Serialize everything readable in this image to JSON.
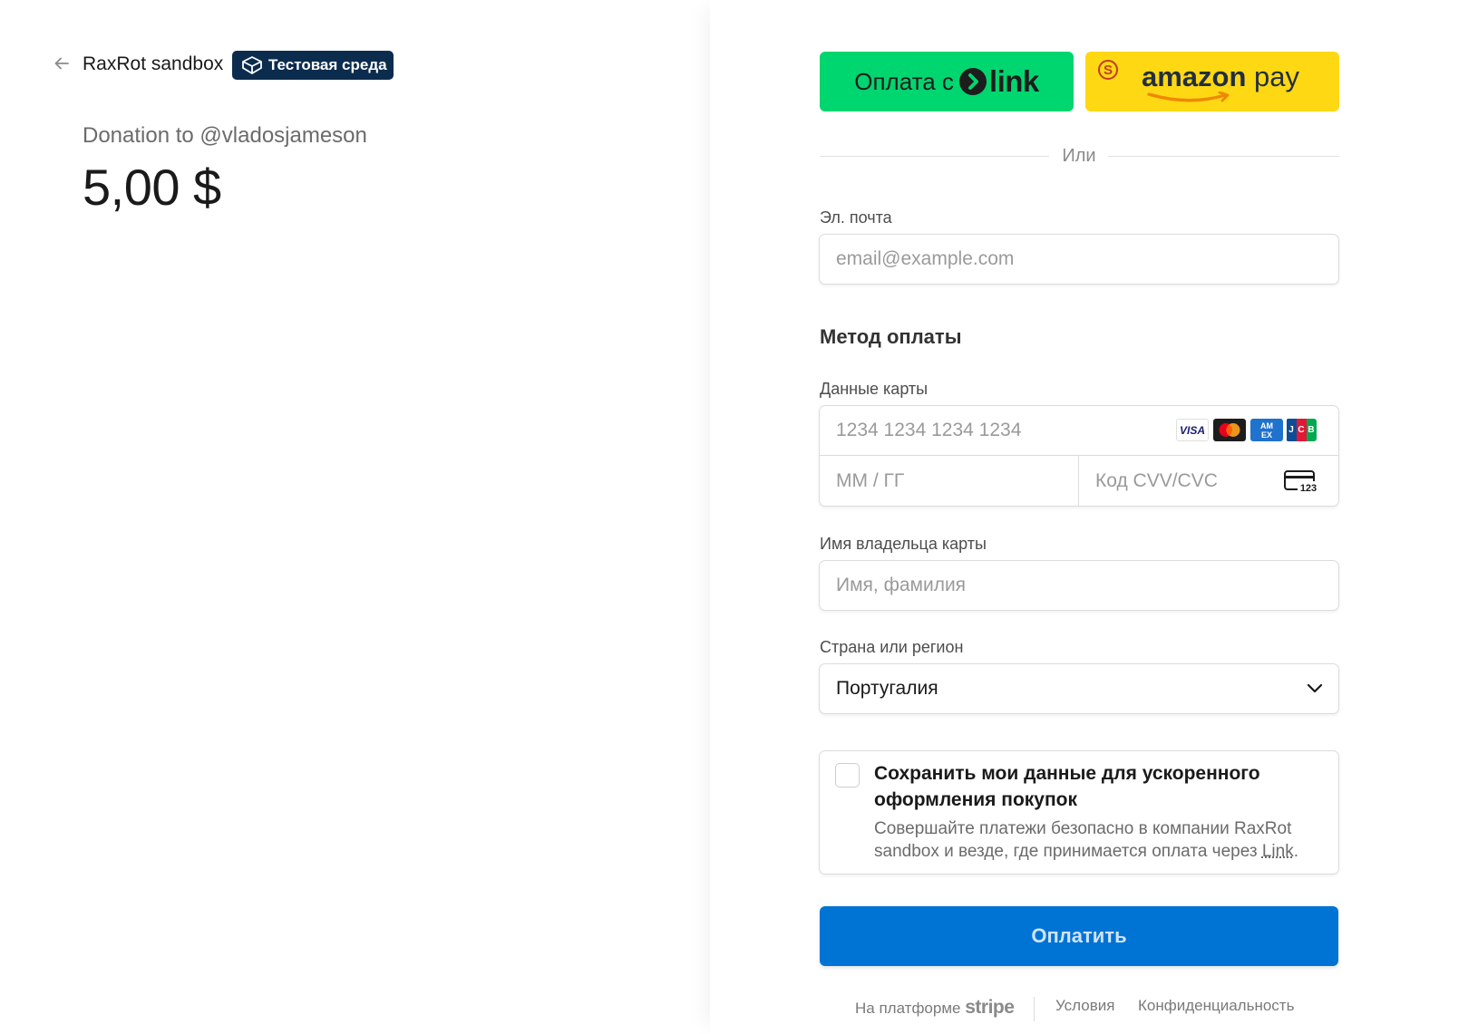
{
  "header": {
    "merchant_name": "RaxRot sandbox",
    "test_badge": "Тестовая среда"
  },
  "summary": {
    "description": "Donation to @vladosjameson",
    "amount": "5,00 $"
  },
  "wallets": {
    "link_prefix": "Оплата с",
    "link_word": "link",
    "amazon_word": "amazon",
    "amazon_pay": "pay"
  },
  "divider_text": "Или",
  "email": {
    "label": "Эл. почта",
    "placeholder": "email@example.com"
  },
  "payment_method_title": "Метод оплаты",
  "card": {
    "label": "Данные карты",
    "number_placeholder": "1234 1234 1234 1234",
    "expiry_placeholder": "ММ / ГГ",
    "cvc_placeholder": "Код CVV/CVC",
    "brands": {
      "visa": "VISA",
      "amex": "AMERICAN EXPRESS",
      "jcb": [
        "J",
        "C",
        "B"
      ]
    },
    "cvc_icon_digits": "123"
  },
  "cardholder": {
    "label": "Имя владельца карты",
    "placeholder": "Имя, фамилия"
  },
  "country": {
    "label": "Страна или регион",
    "selected": "Португалия"
  },
  "save_info": {
    "title": "Сохранить мои данные для ускоренного оформления покупок",
    "description_prefix": "Совершайте платежи безопасно в компании RaxRot sandbox и везде, где принимается оплата через ",
    "link_text": "Link",
    "description_suffix": ".",
    "checked": false
  },
  "pay_button": "Оплатить",
  "footer": {
    "powered_by": "На платформе",
    "stripe": "stripe",
    "terms": "Условия",
    "privacy": "Конфиденциальность"
  },
  "colors": {
    "link_green": "#00d66f",
    "amazon_yellow": "#ffd814",
    "pay_blue": "#0074d4",
    "badge_navy": "#0c2c4e"
  }
}
